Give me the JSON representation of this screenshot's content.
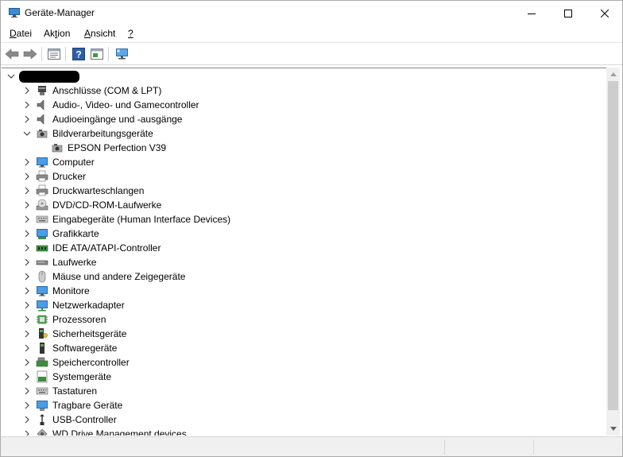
{
  "window": {
    "title": "Geräte-Manager",
    "minimize_glyph": "—",
    "maximize_glyph": "☐",
    "close_glyph": "✕"
  },
  "menu": [
    {
      "prefix": "",
      "underline": "D",
      "rest": "atei"
    },
    {
      "prefix": "Ak",
      "underline": "t",
      "rest": "ion"
    },
    {
      "prefix": "",
      "underline": "A",
      "rest": "nsicht"
    },
    {
      "prefix": "",
      "underline": "?",
      "rest": ""
    }
  ],
  "toolbar": {
    "icons": [
      "back-arrow-icon",
      "forward-arrow-icon",
      "properties-icon",
      "help-icon",
      "action-pane-icon",
      "scan-hardware-icon"
    ]
  },
  "tree": {
    "root_label_redacted": true,
    "categories": [
      {
        "label": "Anschlüsse (COM & LPT)",
        "icon": "port-icon",
        "expanded": false
      },
      {
        "label": "Audio-, Video- und Gamecontroller",
        "icon": "speaker-icon",
        "expanded": false
      },
      {
        "label": "Audioeingänge und -ausgänge",
        "icon": "speaker-icon",
        "expanded": false
      },
      {
        "label": "Bildverarbeitungsgeräte",
        "icon": "camera-icon",
        "expanded": true,
        "children": [
          "EPSON Perfection V39"
        ]
      },
      {
        "label": "Computer",
        "icon": "monitor-icon",
        "expanded": false
      },
      {
        "label": "Drucker",
        "icon": "printer-icon",
        "expanded": false
      },
      {
        "label": "Druckwarteschlangen",
        "icon": "printer-icon",
        "expanded": false
      },
      {
        "label": "DVD/CD-ROM-Laufwerke",
        "icon": "disc-icon",
        "expanded": false
      },
      {
        "label": "Eingabegeräte (Human Interface Devices)",
        "icon": "keyboard-icon",
        "expanded": false
      },
      {
        "label": "Grafikkarte",
        "icon": "display-adapter-icon",
        "expanded": false
      },
      {
        "label": "IDE ATA/ATAPI-Controller",
        "icon": "ide-controller-icon",
        "expanded": false
      },
      {
        "label": "Laufwerke",
        "icon": "drive-icon",
        "expanded": false
      },
      {
        "label": "Mäuse und andere Zeigegeräte",
        "icon": "mouse-icon",
        "expanded": false
      },
      {
        "label": "Monitore",
        "icon": "monitor-icon",
        "expanded": false
      },
      {
        "label": "Netzwerkadapter",
        "icon": "network-icon",
        "expanded": false
      },
      {
        "label": "Prozessoren",
        "icon": "processor-icon",
        "expanded": false
      },
      {
        "label": "Sicherheitsgeräte",
        "icon": "security-icon",
        "expanded": false
      },
      {
        "label": "Softwaregeräte",
        "icon": "software-device-icon",
        "expanded": false
      },
      {
        "label": "Speichercontroller",
        "icon": "storage-controller-icon",
        "expanded": false
      },
      {
        "label": "Systemgeräte",
        "icon": "system-device-icon",
        "expanded": false
      },
      {
        "label": "Tastaturen",
        "icon": "keyboard-icon",
        "expanded": false
      },
      {
        "label": "Tragbare Geräte",
        "icon": "portable-device-icon",
        "expanded": false
      },
      {
        "label": "USB-Controller",
        "icon": "usb-icon",
        "expanded": false
      },
      {
        "label": "WD Drive Management devices",
        "icon": "wd-icon",
        "expanded": false
      }
    ]
  },
  "colors": {
    "accent_blue": "#2a78c7",
    "toolbar_border": "#d9d9d9",
    "scroll_thumb": "#cdcdcd"
  }
}
